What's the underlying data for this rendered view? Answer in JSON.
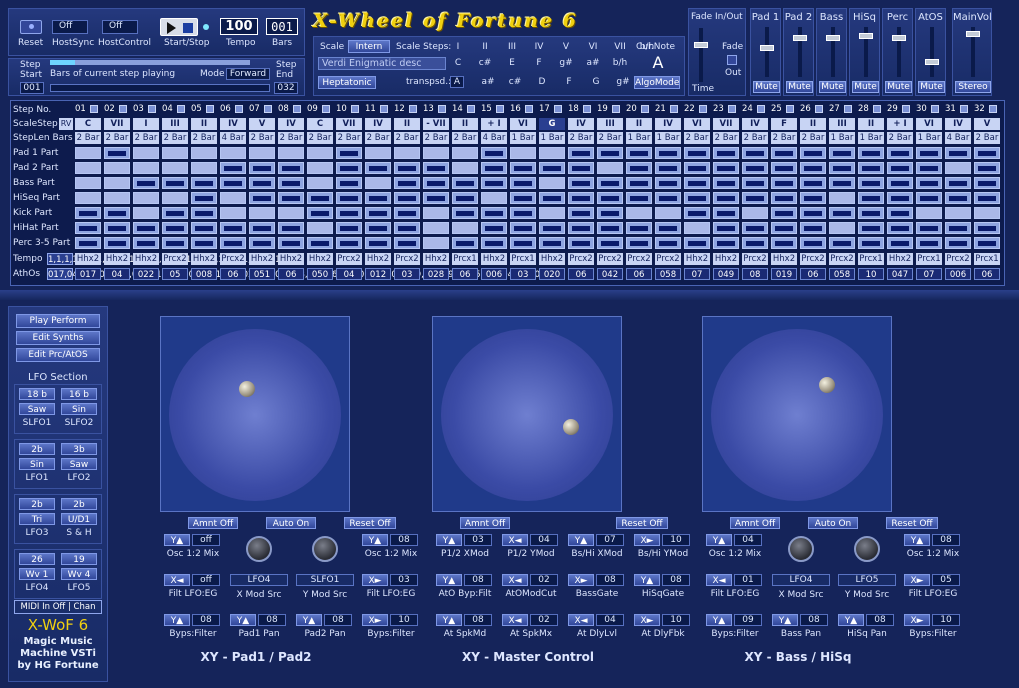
{
  "app": {
    "title": "X-Wheel of Fortune 6"
  },
  "top": {
    "reset": "Reset",
    "hostsync_val": "Off",
    "hostsync": "HostSync",
    "hostcontrol_val": "Off",
    "hostcontrol": "HostControl",
    "startstop": "Start/Stop",
    "tempo_val": "100",
    "tempo": "Tempo",
    "bars_val": "001",
    "bars": "Bars",
    "step": "Step",
    "start": "Start",
    "start_val": "001",
    "bars_of_current": "Bars of current step playing",
    "mode": "Mode",
    "mode_val": "Forward",
    "step_end": "Step",
    "end": "End",
    "end_val": "032"
  },
  "scale": {
    "scale": "Scale",
    "scale_val": "Intern",
    "scale_steps": "Scale Steps:",
    "cur_note": "Cur.Note",
    "desc": "Verdi Enigmatic desc",
    "cur_note_val": "A",
    "mode_name": "Heptatonic",
    "transpsd": "transpsd.:",
    "transpsd_val": "A",
    "algomode": "AlgoMode",
    "degrees": [
      "I",
      "II",
      "III",
      "IV",
      "V",
      "VI",
      "VII",
      "b/h"
    ],
    "notes_row1": [
      "C",
      "c#",
      "E",
      "F",
      "g#",
      "a#",
      "b/h"
    ],
    "notes_row2": [
      "a#",
      "c#",
      "D",
      "F",
      "G",
      "g#"
    ]
  },
  "fade": {
    "title": "Fade In/Out",
    "fade": "Fade",
    "out": "Out",
    "time": "Time"
  },
  "mixer": {
    "channels": [
      {
        "name": "Pad 1",
        "btn": "Mute"
      },
      {
        "name": "Pad 2",
        "btn": "Mute"
      },
      {
        "name": "Bass",
        "btn": "Mute"
      },
      {
        "name": "HiSq",
        "btn": "Mute"
      },
      {
        "name": "Perc",
        "btn": "Mute"
      },
      {
        "name": "AtOS",
        "btn": "Mute"
      },
      {
        "name": "MainVol",
        "btn": "Stereo"
      }
    ]
  },
  "grid": {
    "row_labels": [
      "Step No.",
      "ScaleStep",
      "StepLen Bars",
      "Pad 1 Part",
      "Pad 2 Part",
      "Bass Part",
      "HiSeq Part",
      "Kick Part",
      "HiHat Part",
      "Perc 3-5 Part",
      "Tempo",
      "AthOs"
    ],
    "rv": "RV",
    "perc": [
      1,
      1,
      1,
      1,
      1,
      1,
      1,
      1,
      1,
      1,
      1,
      1,
      0,
      1,
      1,
      1,
      1,
      1,
      1,
      1,
      1,
      1,
      1,
      1,
      1,
      1,
      1,
      1,
      1,
      1,
      1,
      1
    ],
    "level": [
      "017",
      "04",
      "022",
      "05",
      "008",
      "06",
      "051",
      "06",
      "050",
      "04",
      "012",
      "03",
      "028",
      "06",
      "006",
      "03",
      "020",
      "06",
      "042",
      "06",
      "058",
      "07",
      "049",
      "08",
      "019",
      "06",
      "058",
      "10",
      "047",
      "07",
      "006",
      "06"
    ],
    "steps": [
      "01",
      "02",
      "03",
      "04",
      "05",
      "06",
      "07",
      "08",
      "09",
      "10",
      "11",
      "12",
      "13",
      "14",
      "15",
      "16",
      "17",
      "18",
      "19",
      "20",
      "21",
      "22",
      "23",
      "24",
      "25",
      "26",
      "27",
      "28",
      "29",
      "30",
      "31",
      "32"
    ],
    "scalestep": [
      "C",
      "VII",
      "I",
      "III",
      "II",
      "IV",
      "V",
      "IV",
      "C",
      "VII",
      "IV",
      "II",
      "- VII",
      "II",
      "+ I",
      "VI",
      "G",
      "IV",
      "III",
      "II",
      "IV",
      "VI",
      "VII",
      "IV",
      "F",
      "II",
      "III",
      "II",
      "+ I",
      "VI",
      "IV",
      "V"
    ],
    "steplen": [
      "2 Bar",
      "2 Bar",
      "2 Bar",
      "2 Bar",
      "2 Bar",
      "4 Bar",
      "2 Bar",
      "2 Bar",
      "2 Bar",
      "2 Bar",
      "2 Bar",
      "2 Bar",
      "2 Bar",
      "2 Bar",
      "4 Bar",
      "1 Bar",
      "1 Bar",
      "2 Bar",
      "2 Bar",
      "1 Bar",
      "1 Bar",
      "2 Bar",
      "2 Bar",
      "2 Bar",
      "2 Bar",
      "2 Bar",
      "1 Bar",
      "1 Bar",
      "2 Bar",
      "1 Bar",
      "4 Bar",
      "2 Bar"
    ],
    "tempo": [
      "Hhx2",
      "Hhx2",
      "Hhx2",
      "Prcx2",
      "Hhx2",
      "Prcx2",
      "Hhx2",
      "Hhx2",
      "Hhx2",
      "Prcx2",
      "Hhx2",
      "Prcx2",
      "Hhx2",
      "Prcx1",
      "Hhx2",
      "Prcx1",
      "Hhx2",
      "Prcx2",
      "Prcx2",
      "Prcx2",
      "Prcx2",
      "Hhx2",
      "Hhx2",
      "Prcx2",
      "Hhx2",
      "Prcx2",
      "Prcx2",
      "Prcx1",
      "Hhx2",
      "Prcx1",
      "Prcx2",
      "Prcx1"
    ],
    "pad1": [
      0,
      1,
      0,
      0,
      0,
      0,
      0,
      0,
      0,
      1,
      0,
      0,
      0,
      0,
      1,
      0,
      0,
      1,
      1,
      1,
      1,
      1,
      1,
      1,
      1,
      1,
      1,
      1,
      1,
      1,
      1,
      1
    ],
    "pad2": [
      0,
      0,
      0,
      0,
      0,
      1,
      1,
      1,
      0,
      1,
      1,
      1,
      1,
      0,
      1,
      1,
      1,
      1,
      0,
      1,
      1,
      1,
      1,
      1,
      1,
      1,
      1,
      1,
      1,
      1,
      0,
      1
    ],
    "bass": [
      0,
      0,
      1,
      1,
      1,
      1,
      1,
      1,
      0,
      1,
      0,
      1,
      1,
      1,
      1,
      1,
      0,
      1,
      1,
      1,
      1,
      1,
      1,
      1,
      1,
      1,
      1,
      1,
      1,
      1,
      1,
      1
    ],
    "hiseq": [
      0,
      0,
      0,
      0,
      1,
      0,
      1,
      1,
      1,
      1,
      1,
      1,
      1,
      1,
      0,
      1,
      1,
      1,
      1,
      1,
      1,
      1,
      1,
      1,
      1,
      1,
      0,
      1,
      1,
      1,
      1,
      1
    ],
    "kick": [
      1,
      1,
      0,
      1,
      1,
      0,
      0,
      0,
      1,
      1,
      1,
      1,
      0,
      1,
      1,
      1,
      0,
      1,
      1,
      0,
      0,
      1,
      1,
      0,
      1,
      1,
      1,
      1,
      1,
      0,
      0,
      0
    ],
    "hihat": [
      1,
      1,
      1,
      1,
      1,
      1,
      1,
      1,
      0,
      1,
      1,
      1,
      0,
      0,
      1,
      1,
      1,
      1,
      1,
      1,
      1,
      0,
      1,
      1,
      1,
      1,
      0,
      1,
      1,
      1,
      1,
      1
    ]
  },
  "left": {
    "play_perform": "Play Perform",
    "edit_synths": "Edit Synths",
    "edit_prc": "Edit Prc/AtOS",
    "lfo_section": "LFO Section",
    "lfo_blocks": [
      {
        "a_val": "18 b",
        "b_val": "16 b",
        "a_wave": "Saw",
        "b_wave": "Sin",
        "a_name": "SLFO1",
        "b_name": "SLFO2"
      },
      {
        "a_val": "2b",
        "b_val": "3b",
        "a_wave": "Sin",
        "b_wave": "Saw",
        "a_name": "LFO1",
        "b_name": "LFO2"
      },
      {
        "a_val": "2b",
        "b_val": "2b",
        "a_wave": "Tri",
        "b_wave": "U/D1",
        "a_name": "LFO3",
        "b_name": "S & H"
      },
      {
        "a_val": "26",
        "b_val": "19",
        "a_wave": "Wv 1",
        "b_wave": "Wv 4",
        "a_name": "LFO4",
        "b_name": "LFO5"
      }
    ],
    "midi": "MIDI In Off | Chan",
    "brand1": "X-WoF 6",
    "brand2": "Magic Music",
    "brand3": "Machine VSTi",
    "brand4": "by HG Fortune"
  },
  "xy": [
    {
      "title": "XY - Pad1 / Pad2",
      "amnt": "Amnt Off",
      "auto": "Auto On",
      "reset": "Reset Off",
      "ctrls": [
        {
          "tag": "Y▲",
          "val": "off",
          "name": "Osc 1:2 Mix"
        },
        {
          "tag": "",
          "val": "",
          "name": "X Mod Src",
          "knob": true,
          "knobval": "LFO4"
        },
        {
          "tag": "",
          "val": "",
          "name": "Y Mod Src",
          "knob": true,
          "knobval": "SLFO1"
        },
        {
          "tag": "Y▲",
          "val": "08",
          "name": "Osc 1:2 Mix"
        },
        {
          "tag": "X◄",
          "val": "off",
          "name": "Filt LFO:EG"
        },
        {
          "tag": "X►",
          "val": "03",
          "name": "Filt LFO:EG"
        },
        {
          "tag": "Y▲",
          "val": "08",
          "name": "Byps:Filter"
        },
        {
          "tag": "Y▲",
          "val": "08",
          "name": "Pad1 Pan"
        },
        {
          "tag": "Y▲",
          "val": "08",
          "name": "Pad2 Pan"
        },
        {
          "tag": "X►",
          "val": "10",
          "name": "Byps:Filter"
        }
      ]
    },
    {
      "title": "XY - Master Control",
      "amnt": "Amnt Off",
      "auto": "",
      "reset": "Reset Off",
      "ctrls": [
        {
          "tag": "Y▲",
          "val": "03",
          "name": "P1/2 XMod"
        },
        {
          "tag": "X◄",
          "val": "04",
          "name": "P1/2 YMod"
        },
        {
          "tag": "Y▲",
          "val": "07",
          "name": "Bs/Hi XMod"
        },
        {
          "tag": "X►",
          "val": "10",
          "name": "Bs/Hi YMod"
        },
        {
          "tag": "Y▲",
          "val": "08",
          "name": "AtO Byp:Filt"
        },
        {
          "tag": "X◄",
          "val": "02",
          "name": "AtOModCut"
        },
        {
          "tag": "X►",
          "val": "08",
          "name": "BassGate"
        },
        {
          "tag": "Y▲",
          "val": "08",
          "name": "HiSqGate"
        },
        {
          "tag": "Y▲",
          "val": "08",
          "name": "At SpkMd"
        },
        {
          "tag": "X◄",
          "val": "02",
          "name": "At SpkMx"
        },
        {
          "tag": "X◄",
          "val": "04",
          "name": "At DlyLvl"
        },
        {
          "tag": "X►",
          "val": "10",
          "name": "At DlyFbk"
        }
      ]
    },
    {
      "title": "XY - Bass / HiSq",
      "amnt": "Amnt Off",
      "auto": "Auto On",
      "reset": "Reset Off",
      "ctrls": [
        {
          "tag": "Y▲",
          "val": "04",
          "name": "Osc 1:2 Mix"
        },
        {
          "tag": "",
          "val": "",
          "name": "X Mod Src",
          "knob": true,
          "knobval": "LFO4"
        },
        {
          "tag": "",
          "val": "",
          "name": "Y Mod Src",
          "knob": true,
          "knobval": "LFO5"
        },
        {
          "tag": "Y▲",
          "val": "08",
          "name": "Osc 1:2 Mix"
        },
        {
          "tag": "X◄",
          "val": "01",
          "name": "Filt LFO:EG"
        },
        {
          "tag": "X►",
          "val": "05",
          "name": "Filt LFO:EG"
        },
        {
          "tag": "Y▲",
          "val": "09",
          "name": "Byps:Filter"
        },
        {
          "tag": "Y▲",
          "val": "08",
          "name": "Bass Pan"
        },
        {
          "tag": "Y▲",
          "val": "08",
          "name": "HiSq Pan"
        },
        {
          "tag": "X►",
          "val": "10",
          "name": "Byps:Filter"
        }
      ]
    }
  ]
}
